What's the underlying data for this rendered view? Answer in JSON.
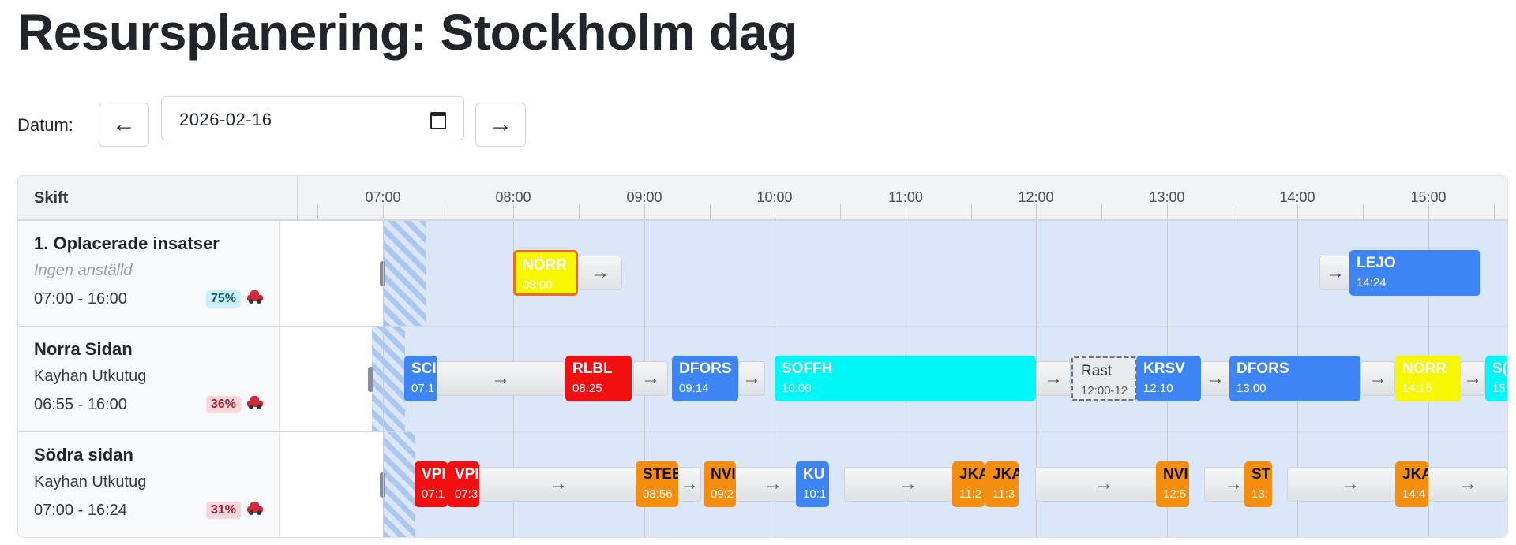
{
  "page": {
    "title": "Resursplanering: Stockholm dag"
  },
  "date_picker": {
    "label": "Datum:",
    "prev_label": "←",
    "next_label": "→",
    "value": "2026-02-16"
  },
  "schedule": {
    "header_label": "Skift",
    "hours": [
      "07:00",
      "08:00",
      "09:00",
      "10:00",
      "11:00",
      "12:00",
      "13:00",
      "14:00",
      "15:00"
    ],
    "travel_arrow": "→",
    "rows": [
      {
        "title": "1. Oplacerade insatser",
        "employee": "Ingen anställd",
        "time": "07:00 - 16:00",
        "utilization": "75%",
        "blocks": [
          {
            "code": "NÖRR",
            "time": "08:00"
          },
          {
            "code": "LEJO",
            "time": "14:24"
          }
        ]
      },
      {
        "title": "Norra Sidan",
        "employee": "Kayhan Utkutug",
        "time": "06:55 - 16:00",
        "utilization": "36%",
        "blocks": [
          {
            "code": "SCI",
            "time": "07:1"
          },
          {
            "code": "RLBL",
            "time": "08:25"
          },
          {
            "code": "DFORS",
            "time": "09:14"
          },
          {
            "code": "SOFFH",
            "time": "10:00"
          },
          {
            "code": "Rast",
            "time": "12:00-12"
          },
          {
            "code": "KRSV",
            "time": "12:10"
          },
          {
            "code": "DFORS",
            "time": "13:00"
          },
          {
            "code": "NÖRR",
            "time": "14:15"
          },
          {
            "code": "S(",
            "time": "15"
          }
        ]
      },
      {
        "title": "Södra sidan",
        "employee": "Kayhan Utkutug",
        "time": "07:00 - 16:24",
        "utilization": "31%",
        "blocks": [
          {
            "code": "VPI",
            "time": "07:1"
          },
          {
            "code": "VPI",
            "time": "07:3"
          },
          {
            "code": "STEE",
            "time": "08:56"
          },
          {
            "code": "NVI",
            "time": "09:2"
          },
          {
            "code": "KU",
            "time": "10:1"
          },
          {
            "code": "JKA",
            "time": "11:2"
          },
          {
            "code": "JKA",
            "time": "11:3"
          },
          {
            "code": "NVI",
            "time": "12:5"
          },
          {
            "code": "ST",
            "time": "13:"
          },
          {
            "code": "JKA",
            "time": "14:4"
          }
        ]
      }
    ]
  }
}
